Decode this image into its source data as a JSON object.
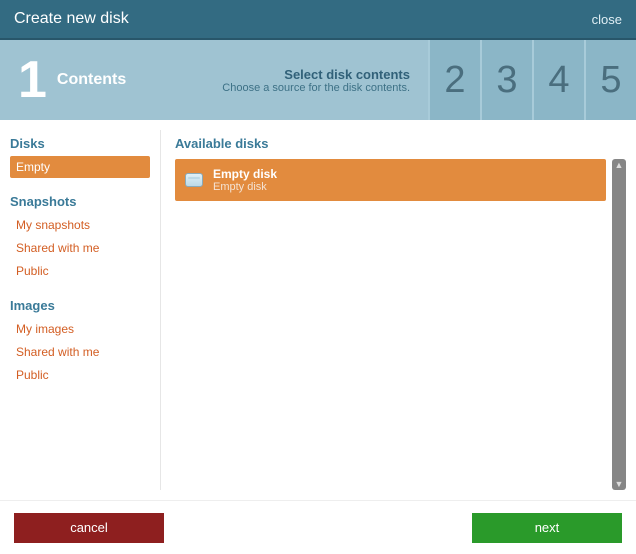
{
  "titlebar": {
    "title": "Create new disk",
    "close": "close"
  },
  "wizard": {
    "current": {
      "num": "1",
      "name": "Contents",
      "subtitle": "Select disk contents",
      "subdesc": "Choose a source for the disk contents."
    },
    "future": [
      "2",
      "3",
      "4",
      "5"
    ]
  },
  "sidebar": {
    "groups": [
      {
        "head": "Disks",
        "items": [
          {
            "label": "Empty",
            "selected": true
          }
        ]
      },
      {
        "head": "Snapshots",
        "items": [
          {
            "label": "My snapshots"
          },
          {
            "label": "Shared with me"
          },
          {
            "label": "Public"
          }
        ]
      },
      {
        "head": "Images",
        "items": [
          {
            "label": "My images"
          },
          {
            "label": "Shared with me"
          },
          {
            "label": "Public"
          }
        ]
      }
    ]
  },
  "main": {
    "head": "Available disks",
    "rows": [
      {
        "title": "Empty disk",
        "sub": "Empty disk"
      }
    ]
  },
  "footer": {
    "cancel": "cancel",
    "next": "next"
  }
}
